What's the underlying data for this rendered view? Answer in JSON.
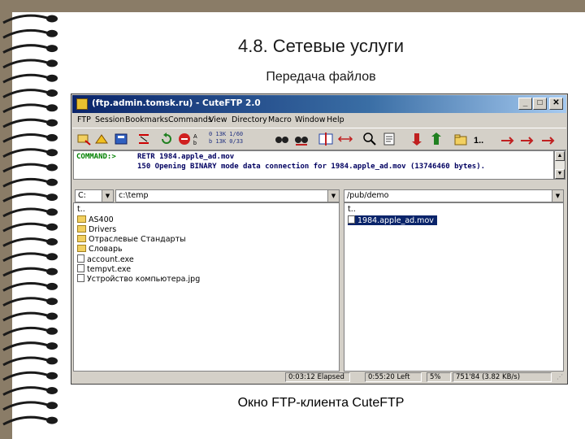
{
  "slide": {
    "title": "4.8. Сетевые услуги",
    "subtitle": "Передача файлов",
    "caption": "Окно FTP-клиента CuteFTP"
  },
  "window": {
    "title": "(ftp.admin.tomsk.ru) - CuteFTP 2.0",
    "controls": {
      "minimize": "_",
      "maximize": "□",
      "close": "✕"
    },
    "menu": [
      "FTP",
      "Session",
      "Bookmarks",
      "Commands",
      "View",
      "Directory",
      "Macro",
      "Window",
      "Help"
    ],
    "toolbar_icons": [
      "connect-icon",
      "quick-connect-icon",
      "bookmarks-icon",
      "disconnect-icon",
      "refresh-icon",
      "stop-icon",
      "transfer-mode-icon",
      "site-settings-icon",
      "binoculars-icon",
      "binoculars-2-icon",
      "connect-window-icon",
      "swap-icon",
      "find-icon",
      "view-icon",
      "download-icon",
      "upload-icon",
      "new-folder-icon",
      "properties-icon",
      "queue-icon",
      "queue-2-icon",
      "queue-3-icon"
    ],
    "stats": {
      "line1": "0  13K  1/60",
      "line2": "b  13K  0/33"
    },
    "log": {
      "label": "COMMAND:>",
      "line1": "RETR 1984.apple_ad.mov",
      "line2": "150 Opening BINARY mode data connection for 1984.apple_ad.mov (13746460 bytes)."
    },
    "local": {
      "drive": "C:",
      "path": "c:\\temp",
      "up": "t..",
      "items": [
        {
          "name": "AS400",
          "type": "folder"
        },
        {
          "name": "Drivers",
          "type": "folder"
        },
        {
          "name": "Отраслевые Стандарты",
          "type": "folder"
        },
        {
          "name": "Словарь",
          "type": "folder"
        },
        {
          "name": "account.exe",
          "type": "file"
        },
        {
          "name": "tempvt.exe",
          "type": "file"
        },
        {
          "name": "Устройство компьютера.jpg",
          "type": "file"
        }
      ]
    },
    "remote": {
      "path": "/pub/demo",
      "up": "t..",
      "items": [
        {
          "name": "1984.apple_ad.mov",
          "type": "file",
          "selected": true
        }
      ]
    },
    "status": {
      "elapsed": "0:03:12 Elapsed",
      "left": "0:55:20 Left",
      "percent": "5%",
      "bytes": "751'84 (3.82 KB/s)"
    },
    "colors": {
      "accent": "#0a246a",
      "selected": "#0a246a",
      "window_bg": "#d4d0c8"
    }
  }
}
